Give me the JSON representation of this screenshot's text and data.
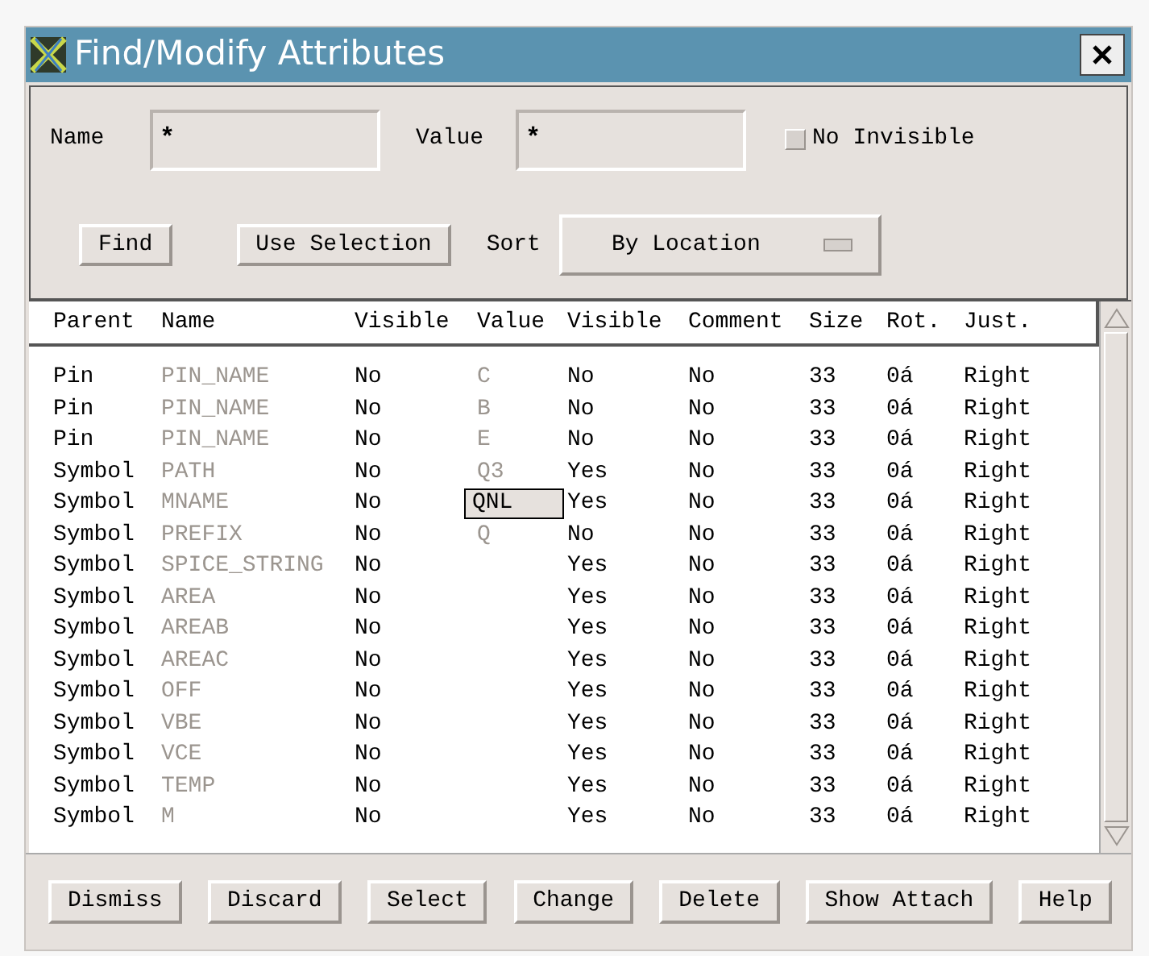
{
  "window": {
    "title": "Find/Modify Attributes"
  },
  "filters": {
    "name_label": "Name",
    "name_value": "*",
    "value_label": "Value",
    "value_value": "*",
    "no_invisible": {
      "label": "No Invisible",
      "checked": false
    }
  },
  "actions": {
    "find": "Find",
    "use_selection": "Use Selection",
    "sort_label": "Sort",
    "sort_value": "By Location"
  },
  "table": {
    "columns": [
      "Parent",
      "Name",
      "Visible",
      "Value",
      "Visible",
      "Comment",
      "Size",
      "Rot.",
      "Just."
    ],
    "rows": [
      {
        "parent": "Pin",
        "name": "PIN_NAME",
        "visible": "No",
        "value": "C",
        "value_visible": "No",
        "comment": "No",
        "size": "33",
        "rot": "0á",
        "just": "Right"
      },
      {
        "parent": "Pin",
        "name": "PIN_NAME",
        "visible": "No",
        "value": "B",
        "value_visible": "No",
        "comment": "No",
        "size": "33",
        "rot": "0á",
        "just": "Right"
      },
      {
        "parent": "Pin",
        "name": "PIN_NAME",
        "visible": "No",
        "value": "E",
        "value_visible": "No",
        "comment": "No",
        "size": "33",
        "rot": "0á",
        "just": "Right"
      },
      {
        "parent": "Symbol",
        "name": "PATH",
        "visible": "No",
        "value": "Q3",
        "value_visible": "Yes",
        "comment": "No",
        "size": "33",
        "rot": "0á",
        "just": "Right"
      },
      {
        "parent": "Symbol",
        "name": "MNAME",
        "visible": "No",
        "value_visible": "Yes",
        "comment": "No",
        "size": "33",
        "rot": "0á",
        "just": "Right",
        "editor": "QNL"
      },
      {
        "parent": "Symbol",
        "name": "PREFIX",
        "visible": "No",
        "value": "Q",
        "value_visible": "No",
        "comment": "No",
        "size": "33",
        "rot": "0á",
        "just": "Right"
      },
      {
        "parent": "Symbol",
        "name": "SPICE_STRING",
        "visible": "No",
        "value_visible": "Yes",
        "comment": "No",
        "size": "33",
        "rot": "0á",
        "just": "Right"
      },
      {
        "parent": "Symbol",
        "name": "AREA",
        "visible": "No",
        "value_visible": "Yes",
        "comment": "No",
        "size": "33",
        "rot": "0á",
        "just": "Right"
      },
      {
        "parent": "Symbol",
        "name": "AREAB",
        "visible": "No",
        "value_visible": "Yes",
        "comment": "No",
        "size": "33",
        "rot": "0á",
        "just": "Right"
      },
      {
        "parent": "Symbol",
        "name": "AREAC",
        "visible": "No",
        "value_visible": "Yes",
        "comment": "No",
        "size": "33",
        "rot": "0á",
        "just": "Right"
      },
      {
        "parent": "Symbol",
        "name": "OFF",
        "visible": "No",
        "value_visible": "Yes",
        "comment": "No",
        "size": "33",
        "rot": "0á",
        "just": "Right"
      },
      {
        "parent": "Symbol",
        "name": "VBE",
        "visible": "No",
        "value_visible": "Yes",
        "comment": "No",
        "size": "33",
        "rot": "0á",
        "just": "Right"
      },
      {
        "parent": "Symbol",
        "name": "VCE",
        "visible": "No",
        "value_visible": "Yes",
        "comment": "No",
        "size": "33",
        "rot": "0á",
        "just": "Right"
      },
      {
        "parent": "Symbol",
        "name": "TEMP",
        "visible": "No",
        "value_visible": "Yes",
        "comment": "No",
        "size": "33",
        "rot": "0á",
        "just": "Right"
      },
      {
        "parent": "Symbol",
        "name": "M",
        "visible": "No",
        "value_visible": "Yes",
        "comment": "No",
        "size": "33",
        "rot": "0á",
        "just": "Right"
      }
    ]
  },
  "buttons": [
    "Dismiss",
    "Discard",
    "Select",
    "Change",
    "Delete",
    "Show Attach",
    "Help"
  ]
}
